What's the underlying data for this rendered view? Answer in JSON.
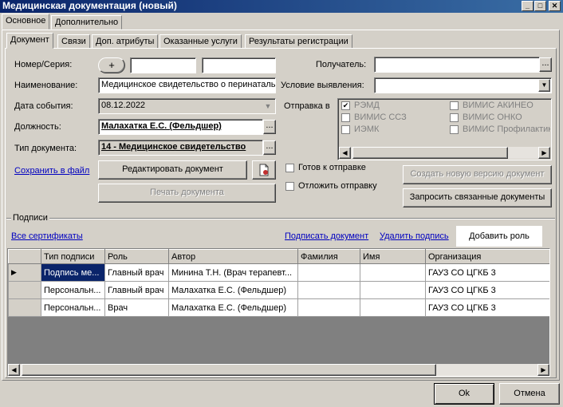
{
  "window": {
    "title": "Медицинская документация (новый)",
    "minimize": "_",
    "maximize": "□",
    "close": "✕"
  },
  "top_tabs": [
    "Основное",
    "Дополнительно"
  ],
  "inner_tabs": [
    "Документ",
    "Связи",
    "Доп. атрибуты",
    "Оказанные услуги",
    "Результаты регистрации"
  ],
  "form": {
    "number_label": "Номер/Серия:",
    "plus": "+",
    "number_value": "",
    "series_value": "",
    "name_label": "Наименование:",
    "name_value": "Медицинское свидетельство о перинаталь",
    "event_date_label": "Дата события:",
    "event_date_value": "08.12.2022",
    "position_label": "Должность:",
    "position_value": "Малахатка Е.С. (Фельдшер)",
    "doctype_label": "Тип документа:",
    "doctype_value": "14 - Медицинское свидетельство",
    "ellipsis": "...",
    "save_to_file": "Сохранить в файл",
    "edit_doc": "Редактировать документ",
    "print_doc": "Печать документа",
    "recipient_label": "Получатель:",
    "recipient_value": "",
    "condition_label": "Условие выявления:",
    "condition_value": "",
    "send_label": "Отправка в",
    "send_targets": [
      {
        "label": "РЭМД",
        "checked": true
      },
      {
        "label": "ВИМИС АКИНЕО",
        "checked": false
      },
      {
        "label": "ВИМИС ССЗ",
        "checked": false
      },
      {
        "label": "ВИМИС ОНКО",
        "checked": false
      },
      {
        "label": "ИЭМК",
        "checked": false
      },
      {
        "label": "ВИМИС Профилактик",
        "checked": false
      }
    ],
    "ready_to_send": "Готов к отправке",
    "postpone_send": "Отложить отправку",
    "create_version": "Создать  новую  версию документ",
    "request_related": "Запросить связанные документы"
  },
  "signatures": {
    "group_label": "Подписи",
    "all_certs": "Все сертификаты",
    "sign_doc": "Подписать документ",
    "delete_sig": "Удалить подпись",
    "add_role": "Добавить роль",
    "columns": [
      "Тип подписи",
      "Роль",
      "Автор",
      "Фамилия",
      "Имя",
      "Организация"
    ],
    "rows": [
      [
        "Подпись ме...",
        "Главный врач",
        "Минина Т.Н. (Врач терапевт...",
        "",
        "",
        "ГАУЗ СО ЦГКБ 3"
      ],
      [
        "Персональн...",
        "Главный врач",
        "Малахатка Е.С. (Фельдшер)",
        "",
        "",
        "ГАУЗ СО ЦГКБ 3"
      ],
      [
        "Персональн...",
        "Врач",
        "Малахатка Е.С. (Фельдшер)",
        "",
        "",
        "ГАУЗ СО ЦГКБ 3"
      ]
    ]
  },
  "footer": {
    "ok": "Ok",
    "cancel": "Отмена"
  }
}
